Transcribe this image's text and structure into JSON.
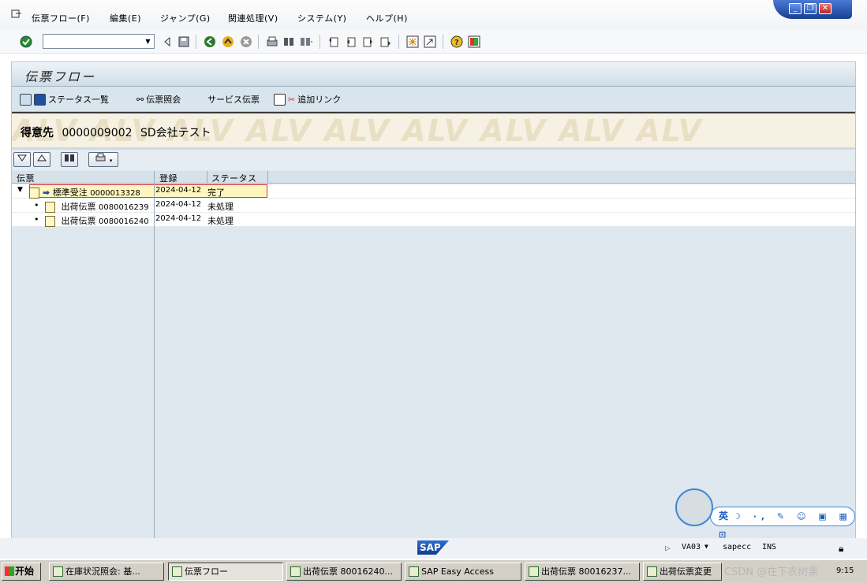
{
  "menubar": {
    "items": [
      "伝票フロー(F)",
      "編集(E)",
      "ジャンプ(G)",
      "関連処理(V)",
      "システム(Y)",
      "ヘルプ(H)"
    ]
  },
  "window_controls": {
    "minimize": "_",
    "restore": "❐",
    "close": "✕"
  },
  "toolbar": {
    "command_field": "",
    "icons": [
      "enter-icon",
      "back-arrow-icon",
      "save-icon",
      "back-icon",
      "exit-icon",
      "cancel-icon",
      "print-icon",
      "find-icon",
      "find-next-icon",
      "first-page-icon",
      "previous-page-icon",
      "next-page-icon",
      "last-page-icon",
      "create-session-icon",
      "shortcut-icon",
      "help-icon",
      "customize-layout-icon"
    ]
  },
  "page": {
    "title": "伝票フロー"
  },
  "app_toolbar": {
    "status_overview": "ステータス一覧",
    "document_display": "伝票照会",
    "service_documents": "サービス伝票",
    "additional_links": "追加リンク"
  },
  "header": {
    "label": "得意先",
    "customer_number": "0000009002",
    "customer_name": "SD会社テスト",
    "watermark": "ALV ALV ALV ALV ALV ALV ALV ALV ALV"
  },
  "tree": {
    "columns": [
      "伝票",
      "登録",
      "ステータス"
    ],
    "rows": [
      {
        "doc_type": "標準受注",
        "doc_number": "0000013328",
        "date": "2024-04-12",
        "status": "完了"
      },
      {
        "doc_type": "出荷伝票",
        "doc_number": "0080016239",
        "date": "2024-04-12",
        "status": "未処理"
      },
      {
        "doc_type": "出荷伝票",
        "doc_number": "0080016240",
        "date": "2024-04-12",
        "status": "未処理"
      }
    ]
  },
  "statusbar": {
    "sap_logo": "SAP",
    "transaction": "VA03",
    "server": "sapecc",
    "mode": "INS"
  },
  "widget": {
    "text": "英"
  },
  "taskbar": {
    "start": "开始",
    "tasks": [
      "在庫状況照会: 基...",
      "伝票フロー",
      "出荷伝票 80016240...",
      "SAP Easy Access",
      "出荷伝票 80016237...",
      "出荷伝票変更"
    ],
    "watermark": "CSDN @在下农树果",
    "clock": "9:15"
  },
  "colors": {
    "accent": "#2d6ed1",
    "header_bg": "#dfe8ef",
    "highlight": "#fff6bf"
  }
}
